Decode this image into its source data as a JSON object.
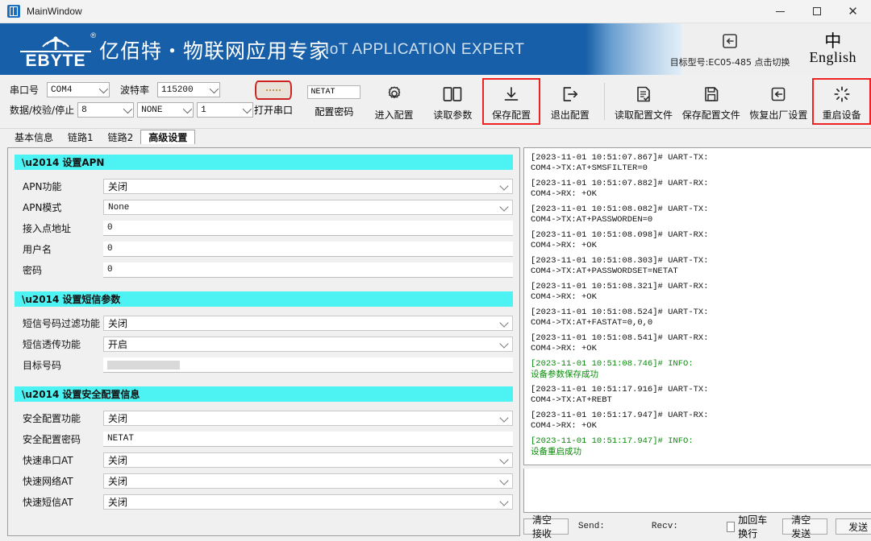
{
  "window": {
    "title": "MainWindow",
    "minimize": "─",
    "maximize": "□",
    "close": "✕"
  },
  "header": {
    "logo_text": "EBYTE",
    "logo_reg": "®",
    "brand_cn": "亿佰特・物联网应用专家",
    "brand_en": "IoT APPLICATION EXPERT",
    "model_label": "目标型号:EC05-485 点击切换",
    "lang_cn": "中",
    "lang_en": "English",
    "blue": "#175fa8"
  },
  "toolbar": {
    "serial": {
      "port_label": "串口号",
      "port_value": "COM4",
      "baud_label": "波特率",
      "baud_value": "115200",
      "data_label": "数据/校验/停止",
      "data_value": "8",
      "parity_value": "NONE",
      "stop_value": "1",
      "open_port": "打开串口"
    },
    "password": {
      "value": "NETAT",
      "label": "配置密码"
    },
    "buttons": [
      {
        "label": "进入配置",
        "icon": "gear-icon",
        "highlight": false
      },
      {
        "label": "读取参数",
        "icon": "book-icon",
        "highlight": false
      },
      {
        "label": "保存配置",
        "icon": "download-icon",
        "highlight": true
      },
      {
        "label": "退出配置",
        "icon": "exit-icon",
        "highlight": false
      },
      {
        "label": "读取配置文件",
        "icon": "document-check-icon",
        "highlight": false
      },
      {
        "label": "保存配置文件",
        "icon": "floppy-icon",
        "highlight": false
      },
      {
        "label": "恢复出厂设置",
        "icon": "restore-icon",
        "highlight": false
      },
      {
        "label": "重启设备",
        "icon": "refresh-icon",
        "highlight": true
      }
    ]
  },
  "tabs": [
    {
      "label": "基本信息",
      "active": false
    },
    {
      "label": "链路1",
      "active": false
    },
    {
      "label": "链路2",
      "active": false
    },
    {
      "label": "高级设置",
      "active": true
    }
  ],
  "sections": [
    {
      "title": "设置APN",
      "fields": [
        {
          "label": "APN功能",
          "value": "关闭",
          "type": "select",
          "cn": true
        },
        {
          "label": "APN模式",
          "value": "None",
          "type": "select",
          "cn": false
        },
        {
          "label": "接入点地址",
          "value": "0",
          "type": "input",
          "cn": false
        },
        {
          "label": "用户名",
          "value": "0",
          "type": "input",
          "cn": false
        },
        {
          "label": "密码",
          "value": "0",
          "type": "input",
          "cn": false
        }
      ]
    },
    {
      "title": "设置短信参数",
      "fields": [
        {
          "label": "短信号码过滤功能",
          "value": "关闭",
          "type": "select",
          "cn": true
        },
        {
          "label": "短信透传功能",
          "value": "开启",
          "type": "select",
          "cn": true
        },
        {
          "label": "目标号码",
          "value": "",
          "type": "redacted",
          "cn": false
        }
      ]
    },
    {
      "title": "设置安全配置信息",
      "fields": [
        {
          "label": "安全配置功能",
          "value": "关闭",
          "type": "select",
          "cn": true
        },
        {
          "label": "安全配置密码",
          "value": "NETAT",
          "type": "input",
          "cn": false
        },
        {
          "label": "快速串口AT",
          "value": "关闭",
          "type": "select",
          "cn": true
        },
        {
          "label": "快速网络AT",
          "value": "关闭",
          "type": "select",
          "cn": true
        },
        {
          "label": "快速短信AT",
          "value": "关闭",
          "type": "select",
          "cn": true
        }
      ]
    }
  ],
  "log": {
    "entries": [
      {
        "kind": "tx",
        "head": "[2023-11-01 10:51:07.867]# UART-TX:",
        "body": "COM4->TX:AT+SMSFILTER=0"
      },
      {
        "kind": "rx",
        "head": "[2023-11-01 10:51:07.882]# UART-RX:",
        "body": "COM4->RX: +OK"
      },
      {
        "kind": "tx",
        "head": "[2023-11-01 10:51:08.082]# UART-TX:",
        "body": "COM4->TX:AT+PASSWORDEN=0"
      },
      {
        "kind": "rx",
        "head": "[2023-11-01 10:51:08.098]# UART-RX:",
        "body": "COM4->RX: +OK"
      },
      {
        "kind": "tx",
        "head": "[2023-11-01 10:51:08.303]# UART-TX:",
        "body": "COM4->TX:AT+PASSWORDSET=NETAT"
      },
      {
        "kind": "rx",
        "head": "[2023-11-01 10:51:08.321]# UART-RX:",
        "body": "COM4->RX: +OK"
      },
      {
        "kind": "tx",
        "head": "[2023-11-01 10:51:08.524]# UART-TX:",
        "body": "COM4->TX:AT+FASTAT=0,0,0"
      },
      {
        "kind": "rx",
        "head": "[2023-11-01 10:51:08.541]# UART-RX:",
        "body": "COM4->RX: +OK"
      },
      {
        "kind": "info",
        "head": "[2023-11-01 10:51:08.746]# INFO:",
        "body": "设备参数保存成功"
      },
      {
        "kind": "tx",
        "head": "[2023-11-01 10:51:17.916]# UART-TX:",
        "body": "COM4->TX:AT+REBT"
      },
      {
        "kind": "rx",
        "head": "[2023-11-01 10:51:17.947]# UART-RX:",
        "body": "COM4->RX: +OK"
      },
      {
        "kind": "info",
        "head": "[2023-11-01 10:51:17.947]# INFO:",
        "body": "设备重启成功"
      }
    ],
    "info_color": "#0a8a0a"
  },
  "bottombar": {
    "clear_recv": "清空接收",
    "send_stat": "Send:",
    "recv_stat": "Recv:",
    "crlf_label": "加回车换行",
    "clear_send": "清空发送",
    "send": "发送",
    "send_value": ""
  }
}
